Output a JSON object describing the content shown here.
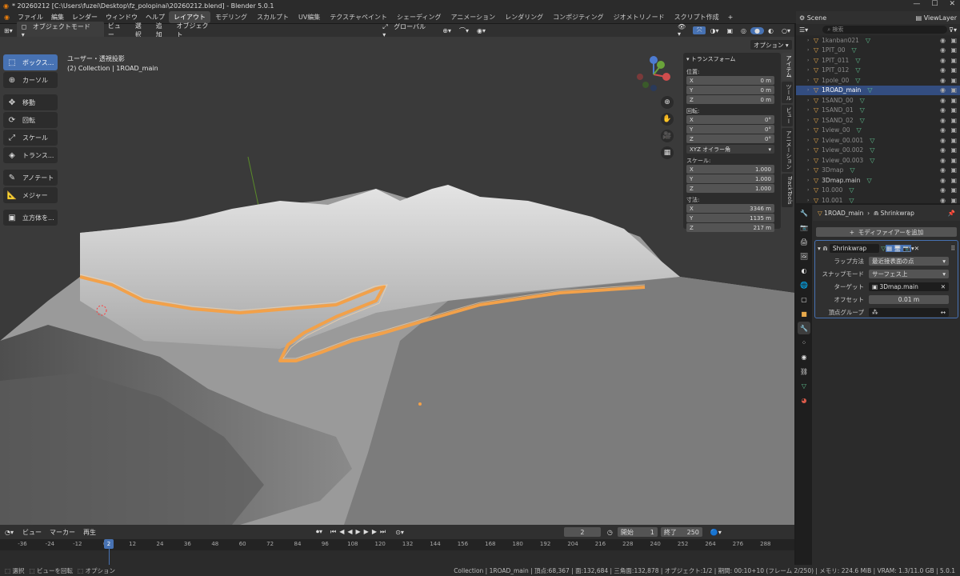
{
  "window": {
    "title": "* 20260212 [C:\\Users\\fuzei\\Desktop\\fz_polopinai\\20260212.blend] - Blender 5.0.1"
  },
  "menu": [
    "ファイル",
    "編集",
    "レンダー",
    "ウィンドウ",
    "ヘルプ"
  ],
  "workspaces": [
    "レイアウト",
    "モデリング",
    "スカルプト",
    "UV編集",
    "テクスチャペイント",
    "シェーディング",
    "アニメーション",
    "レンダリング",
    "コンポジティング",
    "ジオメトリノード",
    "スクリプト作成"
  ],
  "add_workspace": "+",
  "scene": {
    "name": "Scene",
    "viewlayer": "ViewLayer"
  },
  "viewport_header": {
    "mode": "オブジェクトモード",
    "view": "ビュー",
    "select": "選択",
    "add": "追加",
    "object": "オブジェクト",
    "orientation": "グローバル",
    "options": "オプション"
  },
  "tools": [
    "ボックス...",
    "カーソル",
    "移動",
    "回転",
    "スケール",
    "トランス...",
    "アノテート",
    "メジャー",
    "立方体を..."
  ],
  "viewport_info": {
    "line1": "ユーザー・透視投影",
    "line2": "(2) Collection | 1ROAD_main"
  },
  "npanel": {
    "header": "トランスフォーム",
    "location_label": "位置:",
    "location": [
      {
        "axis": "X",
        "value": "0 m"
      },
      {
        "axis": "Y",
        "value": "0 m"
      },
      {
        "axis": "Z",
        "value": "0 m"
      }
    ],
    "rotation_label": "回転:",
    "rotation": [
      {
        "axis": "X",
        "value": "0°"
      },
      {
        "axis": "Y",
        "value": "0°"
      },
      {
        "axis": "Z",
        "value": "0°"
      }
    ],
    "rotation_mode": "XYZ オイラー角",
    "scale_label": "スケール:",
    "scale": [
      {
        "axis": "X",
        "value": "1.000"
      },
      {
        "axis": "Y",
        "value": "1.000"
      },
      {
        "axis": "Z",
        "value": "1.000"
      }
    ],
    "dimensions_label": "寸法:",
    "dimensions": [
      {
        "axis": "X",
        "value": "3346 m"
      },
      {
        "axis": "Y",
        "value": "1135 m"
      },
      {
        "axis": "Z",
        "value": "217 m"
      }
    ]
  },
  "sidebar_tabs": [
    "アイテム",
    "ツール",
    "ビュー",
    "アニメーション",
    "TrackTools"
  ],
  "outliner": {
    "search_placeholder": "検索",
    "items": [
      {
        "name": "1kanban021",
        "dim": true
      },
      {
        "name": "1PIT_00",
        "dim": true
      },
      {
        "name": "1PIT_011",
        "dim": true
      },
      {
        "name": "1PIT_012",
        "dim": true
      },
      {
        "name": "1pole_00",
        "dim": true
      },
      {
        "name": "1ROAD_main",
        "dim": false,
        "selected": true
      },
      {
        "name": "1SAND_00",
        "dim": true
      },
      {
        "name": "1SAND_01",
        "dim": true
      },
      {
        "name": "1SAND_02",
        "dim": true
      },
      {
        "name": "1view_00",
        "dim": true
      },
      {
        "name": "1view_00.001",
        "dim": true
      },
      {
        "name": "1view_00.002",
        "dim": true
      },
      {
        "name": "1view_00.003",
        "dim": true
      },
      {
        "name": "3Dmap",
        "dim": true
      },
      {
        "name": "3Dmap.main",
        "dim": false
      },
      {
        "name": "10.000",
        "dim": true
      },
      {
        "name": "10.001",
        "dim": true
      }
    ]
  },
  "properties": {
    "object": "1ROAD_main",
    "modifier_crumb": "Shrinkwrap",
    "add_modifier": "モディファイアーを追加",
    "modifier_name": "Shrinkwrap",
    "fields": [
      {
        "label": "ラップ方法",
        "value": "最近接表面の点"
      },
      {
        "label": "スナップモード",
        "value": "サーフェス上"
      },
      {
        "label": "ターゲット",
        "value": "3Dmap.main"
      },
      {
        "label": "オフセット",
        "value": "0.01 m"
      },
      {
        "label": "頂点グループ",
        "value": ""
      }
    ]
  },
  "timeline": {
    "menus": [
      "ビュー",
      "マーカー",
      "再生"
    ],
    "current_frame": "2",
    "start_label": "開始",
    "start": "1",
    "end_label": "終了",
    "end": "250",
    "ticks": [
      "-36",
      "-24",
      "-12",
      "0",
      "12",
      "24",
      "36",
      "48",
      "60",
      "72",
      "84",
      "96",
      "108",
      "120",
      "132",
      "144",
      "156",
      "168",
      "180",
      "192",
      "204",
      "216",
      "228",
      "240",
      "252",
      "264",
      "276",
      "288"
    ],
    "playhead": "2"
  },
  "statusbar": {
    "left": [
      "選択",
      "ビューを回転",
      "オプション"
    ],
    "right": "Collection | 1ROAD_main | 頂点:68,367 | 面:132,684 | 三角面:132,878 | オブジェクト:1/2 | 期間: 00:10+10 (フレーム 2/250) | メモリ: 224.6 MiB | VRAM: 1.3/11.0 GB | 5.0.1"
  },
  "colors": {
    "accent": "#4772b3",
    "road": "#f2a14a",
    "selected_row": "#334d80"
  }
}
